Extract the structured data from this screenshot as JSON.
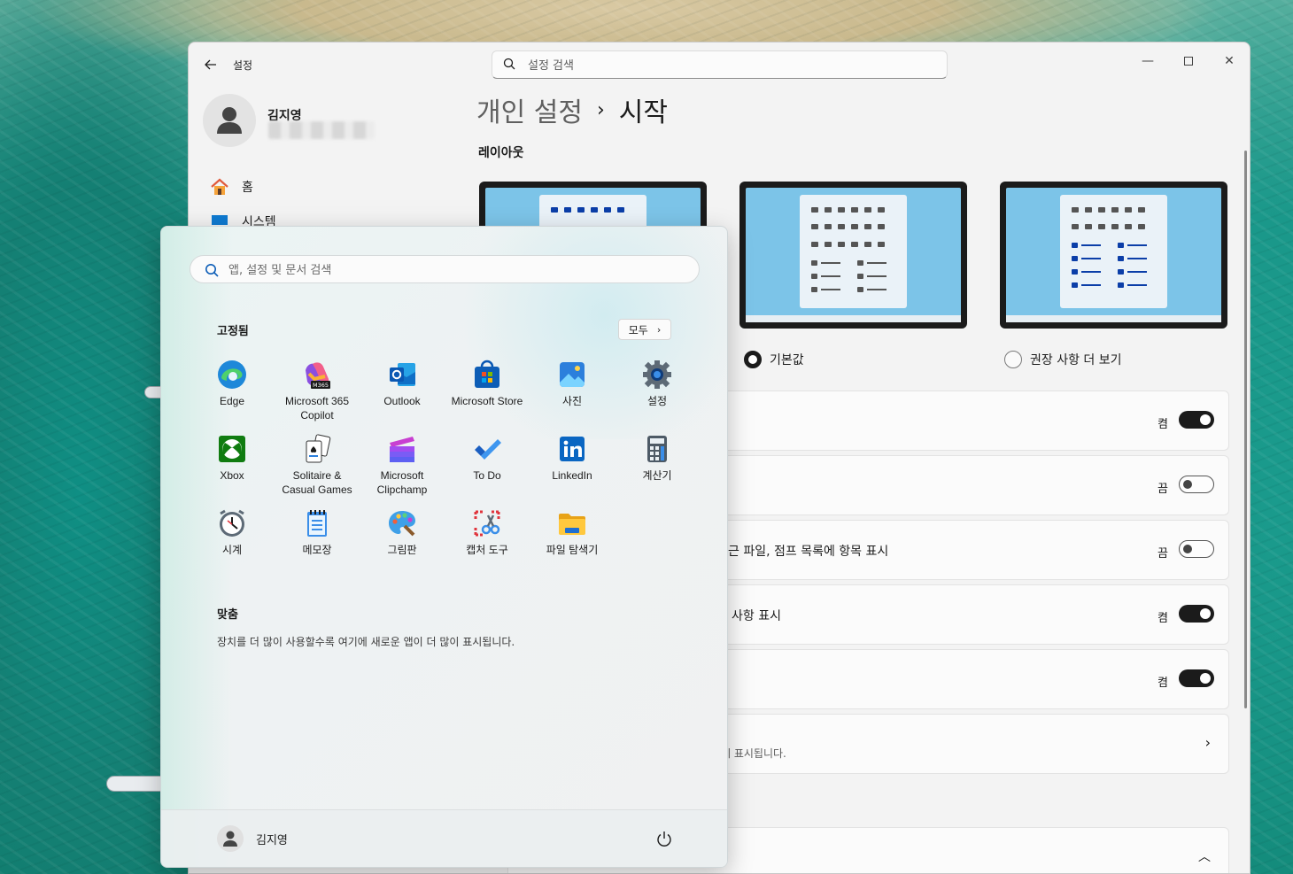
{
  "settings": {
    "app_title": "설정",
    "search_placeholder": "설정 검색",
    "profile_name": "김지영",
    "nav": [
      {
        "label": "홈",
        "icon": "home-icon"
      },
      {
        "label": "시스템",
        "icon": "system-icon"
      }
    ],
    "breadcrumb": {
      "parent": "개인 설정",
      "separator": "›",
      "current": "시작"
    },
    "layout_section": "레이아웃",
    "layout_options": [
      {
        "label": "기본값",
        "selected": true
      },
      {
        "label": "권장 사항 더 보기",
        "selected": false
      }
    ],
    "rows": [
      {
        "label": "",
        "state": "켬",
        "on": true
      },
      {
        "label": "",
        "state": "끔",
        "on": false
      },
      {
        "label": "근 파일, 점프 목록에 항목 표시",
        "state": "끔",
        "on": false
      },
      {
        "label": "사항 표시",
        "state": "켬",
        "on": true
      },
      {
        "label": "",
        "state": "켬",
        "on": true
      },
      {
        "label": "",
        "desc": "에 표시됩니다."
      },
      {
        "label": ""
      }
    ]
  },
  "start_menu": {
    "search_placeholder": "앱, 설정 및 문서 검색",
    "pinned_title": "고정됨",
    "all_button": "모두",
    "apps": [
      {
        "name": "Edge",
        "icon": "edge-icon"
      },
      {
        "name": "Microsoft 365\nCopilot",
        "icon": "m365-copilot-icon",
        "badge": "M365"
      },
      {
        "name": "Outlook",
        "icon": "outlook-icon"
      },
      {
        "name": "Microsoft Store",
        "icon": "store-icon"
      },
      {
        "name": "사진",
        "icon": "photos-icon"
      },
      {
        "name": "설정",
        "icon": "settings-gear-icon"
      },
      {
        "name": "Xbox",
        "icon": "xbox-icon"
      },
      {
        "name": "Solitaire &\nCasual Games",
        "icon": "solitaire-icon"
      },
      {
        "name": "Microsoft\nClipchamp",
        "icon": "clipchamp-icon"
      },
      {
        "name": "To Do",
        "icon": "todo-icon"
      },
      {
        "name": "LinkedIn",
        "icon": "linkedin-icon"
      },
      {
        "name": "계산기",
        "icon": "calculator-icon"
      },
      {
        "name": "시계",
        "icon": "clock-icon"
      },
      {
        "name": "메모장",
        "icon": "notepad-icon"
      },
      {
        "name": "그림판",
        "icon": "paint-icon"
      },
      {
        "name": "캡처 도구",
        "icon": "snipping-tool-icon"
      },
      {
        "name": "파일 탐색기",
        "icon": "file-explorer-icon"
      }
    ],
    "recommended_title": "맞춤",
    "recommended_text": "장치를 더 많이 사용할수록 여기에 새로운 앱이 더 많이 표시됩니다.",
    "user_name": "김지영"
  }
}
